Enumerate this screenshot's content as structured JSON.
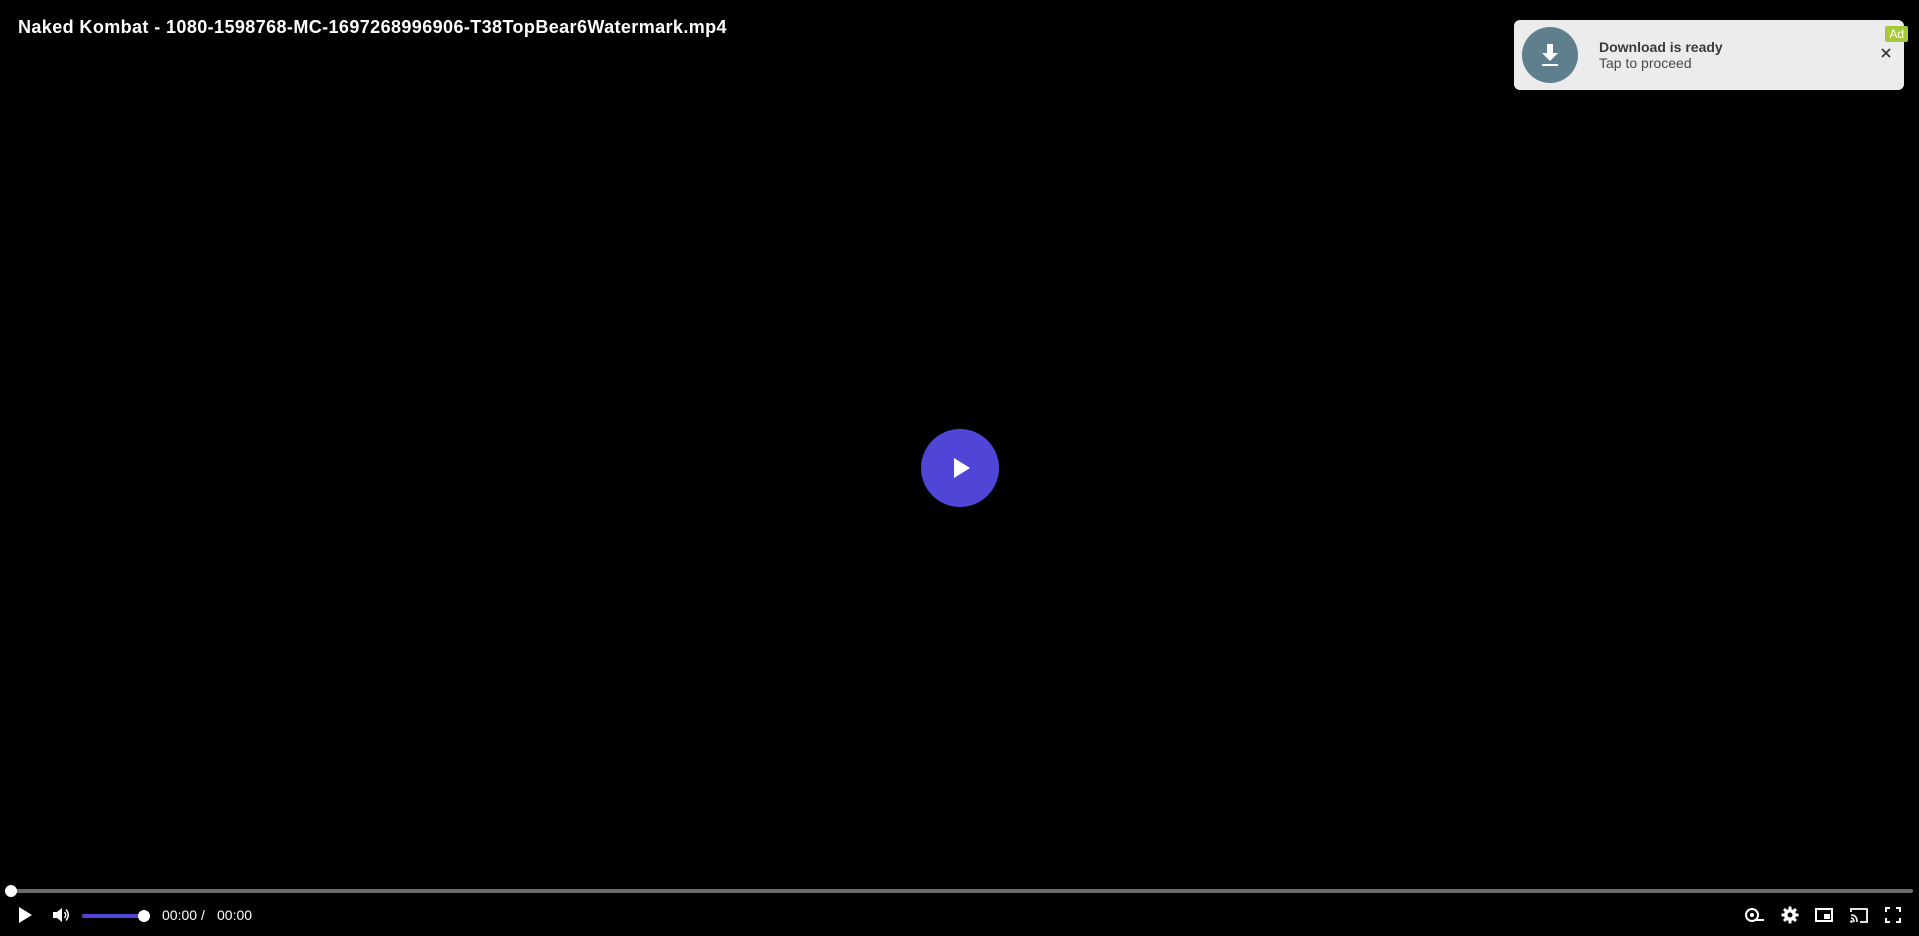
{
  "video": {
    "title": "Naked Kombat - 1080-1598768-MC-1697268996906-T38TopBear6Watermark.mp4"
  },
  "ad": {
    "title": "Download is ready",
    "subtitle": "Tap to proceed",
    "badge": "Ad",
    "close_glyph": "✕",
    "icon": "download-icon"
  },
  "player": {
    "progress": 0,
    "volume": 1.0,
    "current_time": "00:00",
    "separator": "/",
    "duration": "00:00"
  },
  "colors": {
    "accent": "#4f46d8",
    "background": "#000000",
    "ad_background": "#ececec",
    "ad_icon_bg": "#5f7f8e",
    "ad_badge": "#a6c83a"
  },
  "controls": {
    "left": [
      "play-icon",
      "volume-icon"
    ],
    "right": [
      "speed-icon",
      "settings-gear-icon",
      "picture-in-picture-icon",
      "cast-icon",
      "fullscreen-icon"
    ]
  }
}
